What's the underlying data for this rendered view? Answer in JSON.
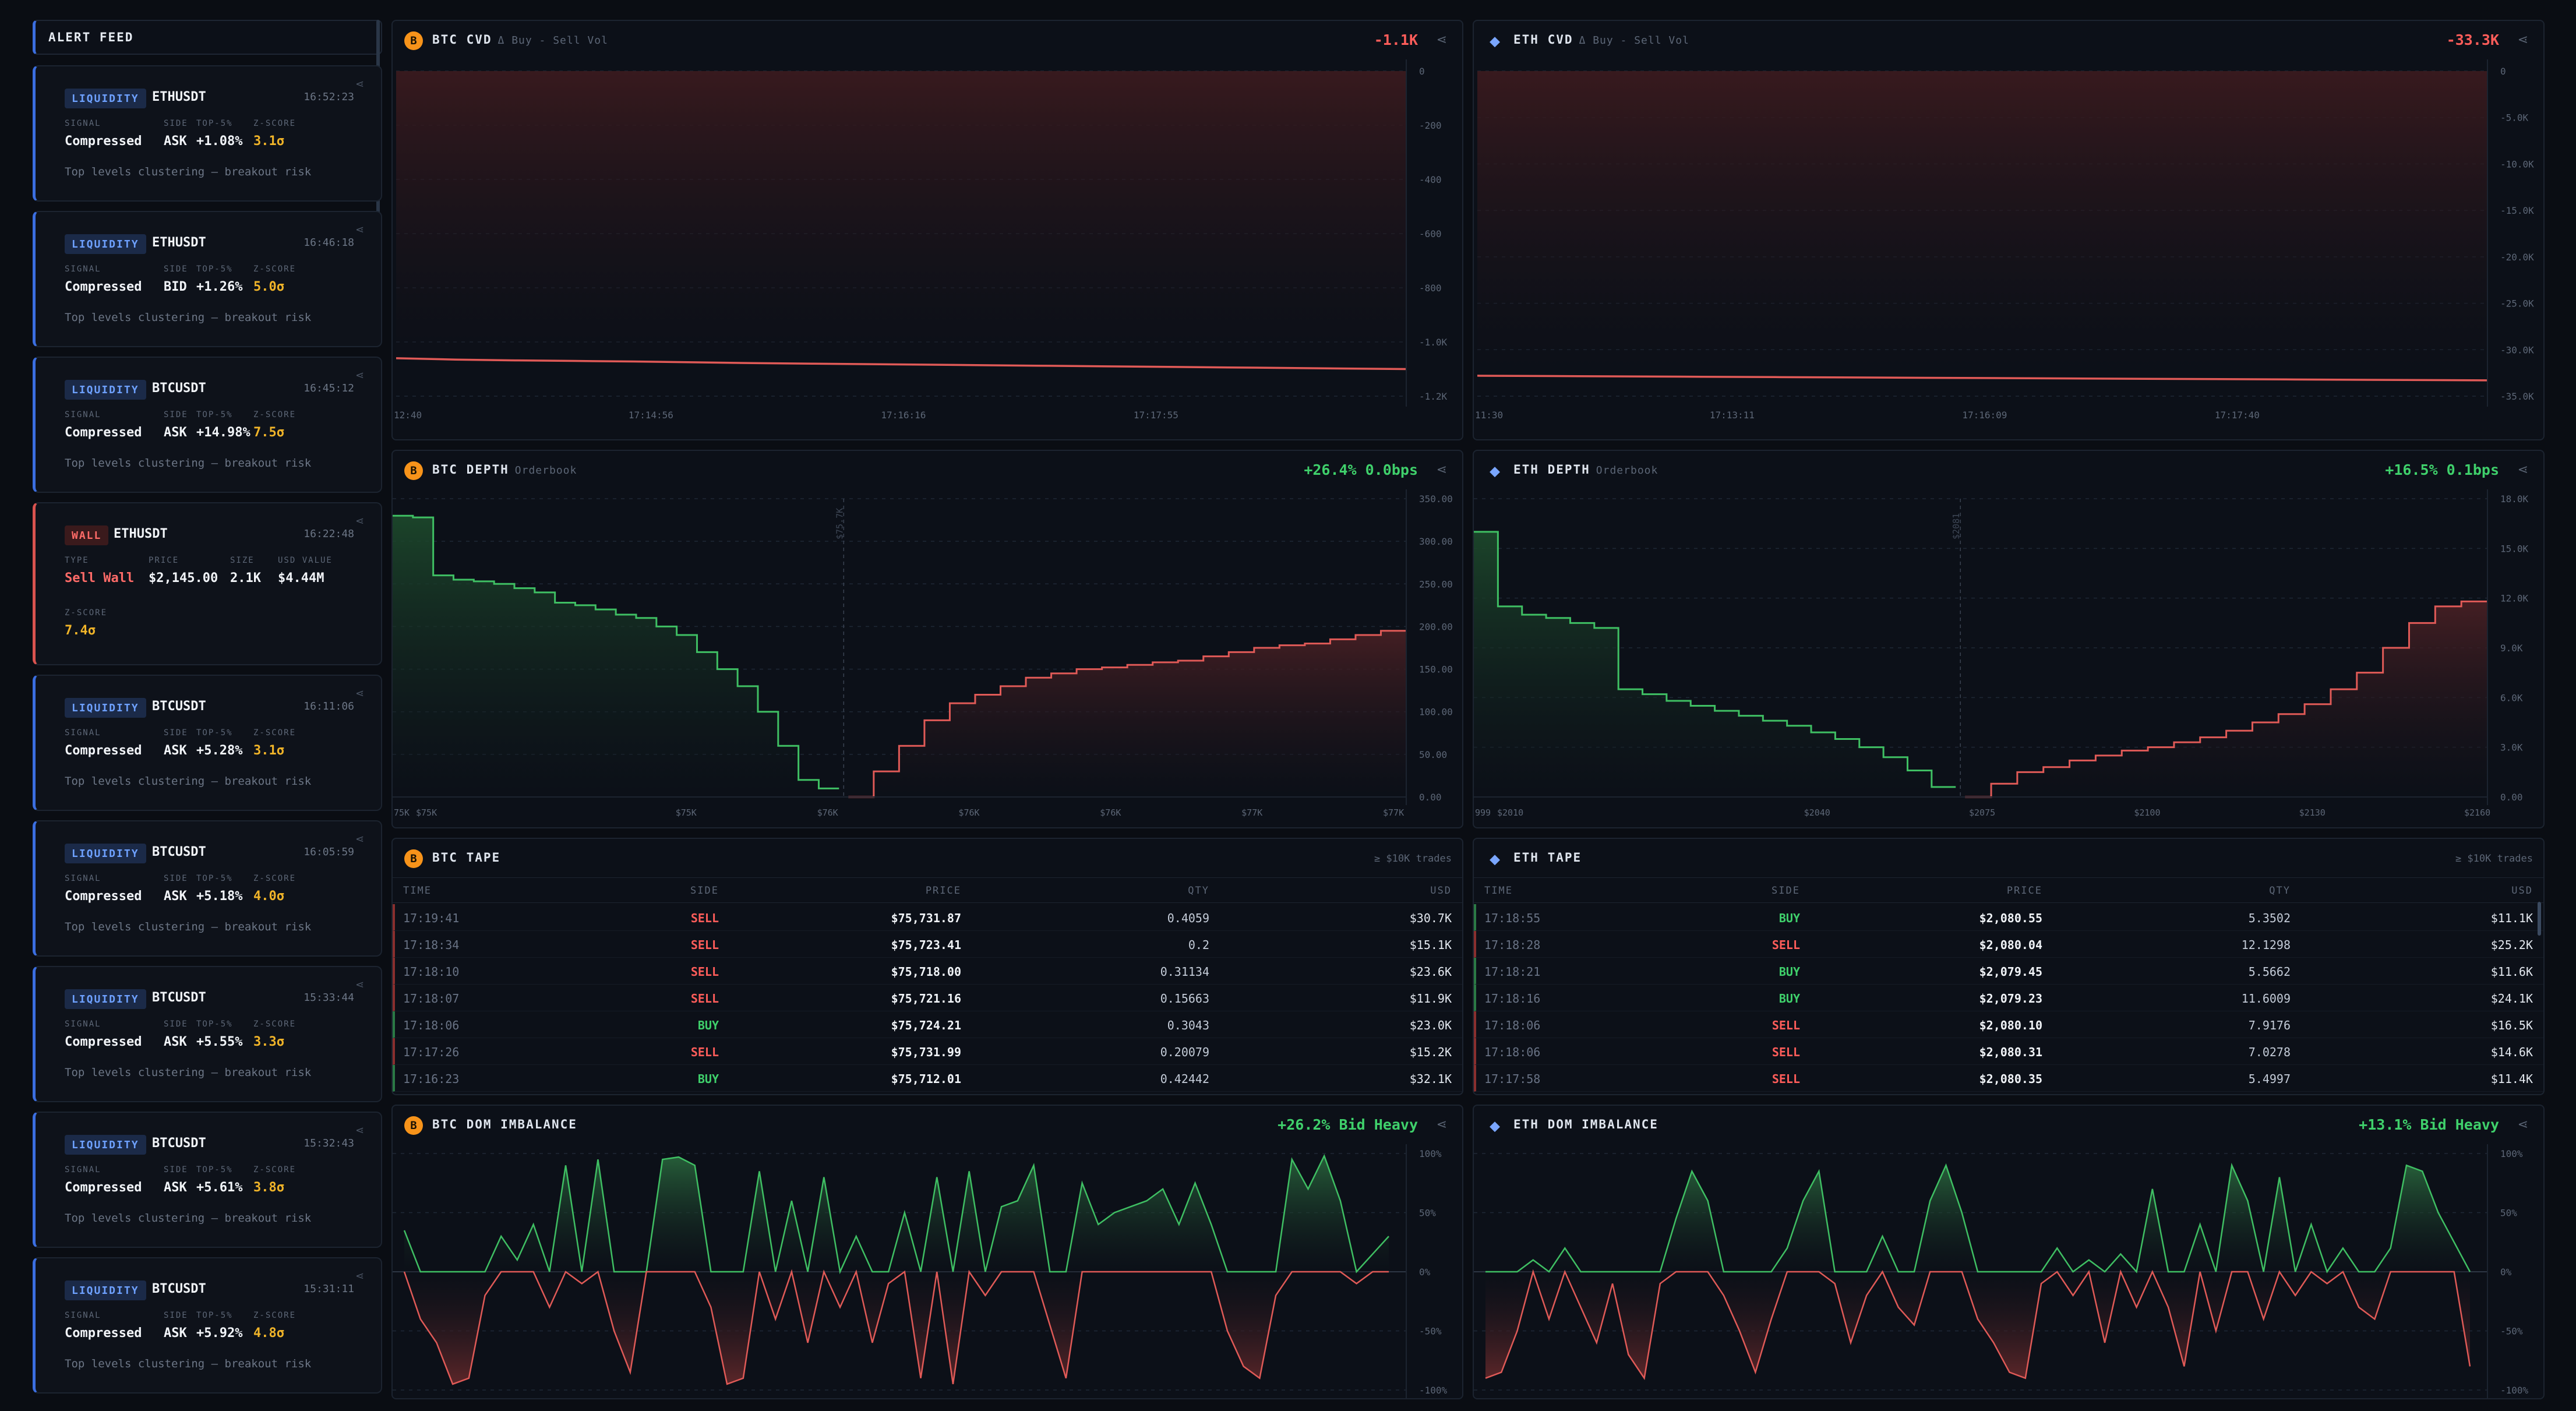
{
  "feed": {
    "title": "ALERT FEED",
    "alerts": [
      {
        "badge": "LIQUIDITY",
        "symbol": "ETHUSDT",
        "time": "16:52:23",
        "labels": [
          "SIGNAL",
          "SIDE",
          "TOP-5%",
          "Z-SCORE"
        ],
        "values": [
          "Compressed",
          "ASK",
          "+1.08%",
          "3.1σ"
        ],
        "note": "Top levels clustering — breakout risk"
      },
      {
        "badge": "LIQUIDITY",
        "symbol": "ETHUSDT",
        "time": "16:46:18",
        "labels": [
          "SIGNAL",
          "SIDE",
          "TOP-5%",
          "Z-SCORE"
        ],
        "values": [
          "Compressed",
          "BID",
          "+1.26%",
          "5.0σ"
        ],
        "note": "Top levels clustering — breakout risk"
      },
      {
        "badge": "LIQUIDITY",
        "symbol": "BTCUSDT",
        "time": "16:45:12",
        "labels": [
          "SIGNAL",
          "SIDE",
          "TOP-5%",
          "Z-SCORE"
        ],
        "values": [
          "Compressed",
          "ASK",
          "+14.98%",
          "7.5σ"
        ],
        "note": "Top levels clustering — breakout risk"
      },
      {
        "badge": "WALL",
        "symbol": "ETHUSDT",
        "time": "16:22:48",
        "labels": [
          "TYPE",
          "PRICE",
          "SIZE",
          "USD VALUE"
        ],
        "values": [
          "Sell Wall",
          "$2,145.00",
          "2.1K",
          "$4.44M"
        ],
        "zlabel": "Z-SCORE",
        "zvalue": "7.4σ"
      },
      {
        "badge": "LIQUIDITY",
        "symbol": "BTCUSDT",
        "time": "16:11:06",
        "labels": [
          "SIGNAL",
          "SIDE",
          "TOP-5%",
          "Z-SCORE"
        ],
        "values": [
          "Compressed",
          "ASK",
          "+5.28%",
          "3.1σ"
        ],
        "note": "Top levels clustering — breakout risk"
      },
      {
        "badge": "LIQUIDITY",
        "symbol": "BTCUSDT",
        "time": "16:05:59",
        "labels": [
          "SIGNAL",
          "SIDE",
          "TOP-5%",
          "Z-SCORE"
        ],
        "values": [
          "Compressed",
          "ASK",
          "+5.18%",
          "4.0σ"
        ],
        "note": "Top levels clustering — breakout risk"
      },
      {
        "badge": "LIQUIDITY",
        "symbol": "BTCUSDT",
        "time": "15:33:44",
        "labels": [
          "SIGNAL",
          "SIDE",
          "TOP-5%",
          "Z-SCORE"
        ],
        "values": [
          "Compressed",
          "ASK",
          "+5.55%",
          "3.3σ"
        ],
        "note": "Top levels clustering — breakout risk"
      },
      {
        "badge": "LIQUIDITY",
        "symbol": "BTCUSDT",
        "time": "15:32:43",
        "labels": [
          "SIGNAL",
          "SIDE",
          "TOP-5%",
          "Z-SCORE"
        ],
        "values": [
          "Compressed",
          "ASK",
          "+5.61%",
          "3.8σ"
        ],
        "note": "Top levels clustering — breakout risk"
      },
      {
        "badge": "LIQUIDITY",
        "symbol": "BTCUSDT",
        "time": "15:31:11",
        "labels": [
          "SIGNAL",
          "SIDE",
          "TOP-5%",
          "Z-SCORE"
        ],
        "values": [
          "Compressed",
          "ASK",
          "+5.92%",
          "4.8σ"
        ],
        "note": "Top levels clustering — breakout risk"
      }
    ]
  },
  "colors": {
    "bg": "#0a0d13",
    "panel": "#0c1018",
    "accent": "#3b6ee0",
    "buy": "#3fd06b",
    "sell": "#ff5d5a",
    "btc": "#f7931a",
    "eth": "#7aa6ff",
    "zscore": "#f0b429"
  },
  "icons": {
    "btc": "bitcoin-icon",
    "eth": "ethereum-icon",
    "share": "share-icon"
  },
  "btc_cvd": {
    "coin": "B",
    "title": "BTC CVD",
    "subtitle": "Δ Buy - Sell Vol",
    "value": "-1.1K"
  },
  "eth_cvd": {
    "coin": "◆",
    "title": "ETH CVD",
    "subtitle": "Δ Buy - Sell Vol",
    "value": "-33.3K"
  },
  "btc_depth": {
    "coin": "B",
    "title": "BTC DEPTH",
    "subtitle": "Orderbook",
    "value": "+26.4% 0.0bps"
  },
  "eth_depth": {
    "coin": "◆",
    "title": "ETH DEPTH",
    "subtitle": "Orderbook",
    "value": "+16.5% 0.1bps"
  },
  "btc_tape": {
    "coin": "B",
    "title": "BTC TAPE",
    "filter": "≥ $10K trades",
    "columns": [
      "TIME",
      "SIDE",
      "PRICE",
      "QTY",
      "USD"
    ],
    "rows": [
      [
        "17:19:41",
        "SELL",
        "$75,731.87",
        "0.4059",
        "$30.7K"
      ],
      [
        "17:18:34",
        "SELL",
        "$75,723.41",
        "0.2",
        "$15.1K"
      ],
      [
        "17:18:10",
        "SELL",
        "$75,718.00",
        "0.31134",
        "$23.6K"
      ],
      [
        "17:18:07",
        "SELL",
        "$75,721.16",
        "0.15663",
        "$11.9K"
      ],
      [
        "17:18:06",
        "BUY",
        "$75,724.21",
        "0.3043",
        "$23.0K"
      ],
      [
        "17:17:26",
        "SELL",
        "$75,731.99",
        "0.20079",
        "$15.2K"
      ],
      [
        "17:16:23",
        "BUY",
        "$75,712.01",
        "0.42442",
        "$32.1K"
      ]
    ]
  },
  "eth_tape": {
    "coin": "◆",
    "title": "ETH TAPE",
    "filter": "≥ $10K trades",
    "columns": [
      "TIME",
      "SIDE",
      "PRICE",
      "QTY",
      "USD"
    ],
    "rows": [
      [
        "17:18:55",
        "BUY",
        "$2,080.55",
        "5.3502",
        "$11.1K"
      ],
      [
        "17:18:28",
        "SELL",
        "$2,080.04",
        "12.1298",
        "$25.2K"
      ],
      [
        "17:18:21",
        "BUY",
        "$2,079.45",
        "5.5662",
        "$11.6K"
      ],
      [
        "17:18:16",
        "BUY",
        "$2,079.23",
        "11.6009",
        "$24.1K"
      ],
      [
        "17:18:06",
        "SELL",
        "$2,080.10",
        "7.9176",
        "$16.5K"
      ],
      [
        "17:18:06",
        "SELL",
        "$2,080.31",
        "7.0278",
        "$14.6K"
      ],
      [
        "17:17:58",
        "SELL",
        "$2,080.35",
        "5.4997",
        "$11.4K"
      ]
    ]
  },
  "btc_dom": {
    "coin": "B",
    "title": "BTC DOM IMBALANCE",
    "value": "+26.2% Bid Heavy"
  },
  "eth_dom": {
    "coin": "◆",
    "title": "ETH DOM IMBALANCE",
    "value": "+13.1% Bid Heavy"
  },
  "chart_data": [
    {
      "id": "btc_cvd",
      "type": "line",
      "x": [
        "17:14:56",
        "17:16:16",
        "17:17:55"
      ],
      "x_ticks": [
        "12:40",
        "17:14:56",
        "17:16:16",
        "17:17:55"
      ],
      "y_ticks": [
        "0",
        "-200",
        "-400",
        "-600",
        "-800",
        "-1.0K",
        "-1.2K"
      ],
      "ylim": [
        -1200,
        0
      ],
      "values": [
        -1060,
        -1065,
        -1068,
        -1070,
        -1072,
        -1075,
        -1078,
        -1080,
        -1082,
        -1084,
        -1086,
        -1088,
        -1090,
        -1092,
        -1094,
        -1096,
        -1098,
        -1100
      ]
    },
    {
      "id": "eth_cvd",
      "type": "line",
      "x_ticks": [
        "11:30",
        "17:13:11",
        "17:16:09",
        "17:17:40"
      ],
      "y_ticks": [
        "0",
        "-5.0K",
        "-10.0K",
        "-15.0K",
        "-20.0K",
        "-25.0K",
        "-30.0K",
        "-35.0K"
      ],
      "ylim": [
        -35000,
        0
      ],
      "values": [
        -32800,
        -32850,
        -32900,
        -32950,
        -33000,
        -33050,
        -33100,
        -33150,
        -33200,
        -33250,
        -33300
      ]
    },
    {
      "id": "btc_depth",
      "type": "area",
      "x_ticks": [
        "75K",
        "$75K",
        "$75K",
        "$76K",
        "$76K",
        "$76K",
        "$77K",
        "$77K"
      ],
      "y_ticks": [
        "350.00",
        "300.00",
        "250.00",
        "200.00",
        "150.00",
        "100.00",
        "50.00",
        "0.00"
      ],
      "ylim": [
        0,
        350
      ],
      "mid_label": "$75.7K",
      "bids": [
        330,
        328,
        260,
        255,
        253,
        250,
        245,
        240,
        228,
        225,
        220,
        214,
        210,
        200,
        190,
        170,
        150,
        130,
        100,
        60,
        20,
        10
      ],
      "asks": [
        0,
        30,
        60,
        90,
        110,
        120,
        130,
        140,
        145,
        150,
        152,
        155,
        158,
        160,
        165,
        170,
        175,
        178,
        180,
        185,
        190,
        195
      ]
    },
    {
      "id": "eth_depth",
      "type": "area",
      "x_ticks": [
        "999",
        "$2010",
        "$2040",
        "$2075",
        "$2100",
        "$2130",
        "$2160"
      ],
      "y_ticks": [
        "18.0K",
        "15.0K",
        "12.0K",
        "9.0K",
        "6.0K",
        "3.0K",
        "0.00"
      ],
      "ylim": [
        0,
        18000
      ],
      "mid_label": "$2081",
      "bids": [
        16000,
        11500,
        11000,
        10800,
        10500,
        10200,
        6500,
        6200,
        5800,
        5500,
        5200,
        4900,
        4600,
        4300,
        3900,
        3500,
        3000,
        2400,
        1600,
        600
      ],
      "asks": [
        0,
        800,
        1500,
        1800,
        2200,
        2500,
        2800,
        3000,
        3300,
        3600,
        4000,
        4500,
        5000,
        5600,
        6500,
        7500,
        9000,
        10500,
        11500,
        11800
      ]
    },
    {
      "id": "btc_dom",
      "type": "area",
      "y_ticks": [
        "100%",
        "50%",
        "0%",
        "-50%",
        "-100%"
      ],
      "ylim": [
        -100,
        100
      ],
      "values": [
        35,
        -40,
        -60,
        -95,
        -90,
        -20,
        30,
        10,
        40,
        -30,
        90,
        -10,
        95,
        -50,
        -85,
        0,
        95,
        97,
        90,
        -30,
        -95,
        -90,
        85,
        -40,
        60,
        -60,
        80,
        -30,
        30,
        -60,
        -10,
        50,
        -90,
        80,
        -95,
        85,
        -20,
        55,
        60,
        90,
        -45,
        -90,
        75,
        40,
        50,
        55,
        60,
        70,
        40,
        75,
        40,
        -50,
        -80,
        -90,
        -20,
        95,
        70,
        98,
        60,
        -10,
        15,
        30
      ]
    },
    {
      "id": "eth_dom",
      "type": "area",
      "y_ticks": [
        "100%",
        "50%",
        "0%",
        "-50%",
        "-100%"
      ],
      "ylim": [
        -100,
        100
      ],
      "values": [
        -90,
        -85,
        -50,
        10,
        -40,
        20,
        -30,
        -60,
        -10,
        -70,
        -90,
        -10,
        45,
        85,
        60,
        -20,
        -50,
        -85,
        -40,
        20,
        60,
        85,
        -10,
        -60,
        -20,
        30,
        -30,
        -45,
        60,
        90,
        50,
        -40,
        -60,
        -85,
        -90,
        -10,
        20,
        -20,
        10,
        -60,
        15,
        -30,
        70,
        -30,
        -80,
        40,
        -50,
        90,
        60,
        -40,
        80,
        -20,
        40,
        -10,
        20,
        -30,
        -40,
        20,
        90,
        85,
        50,
        25,
        -80
      ]
    }
  ]
}
